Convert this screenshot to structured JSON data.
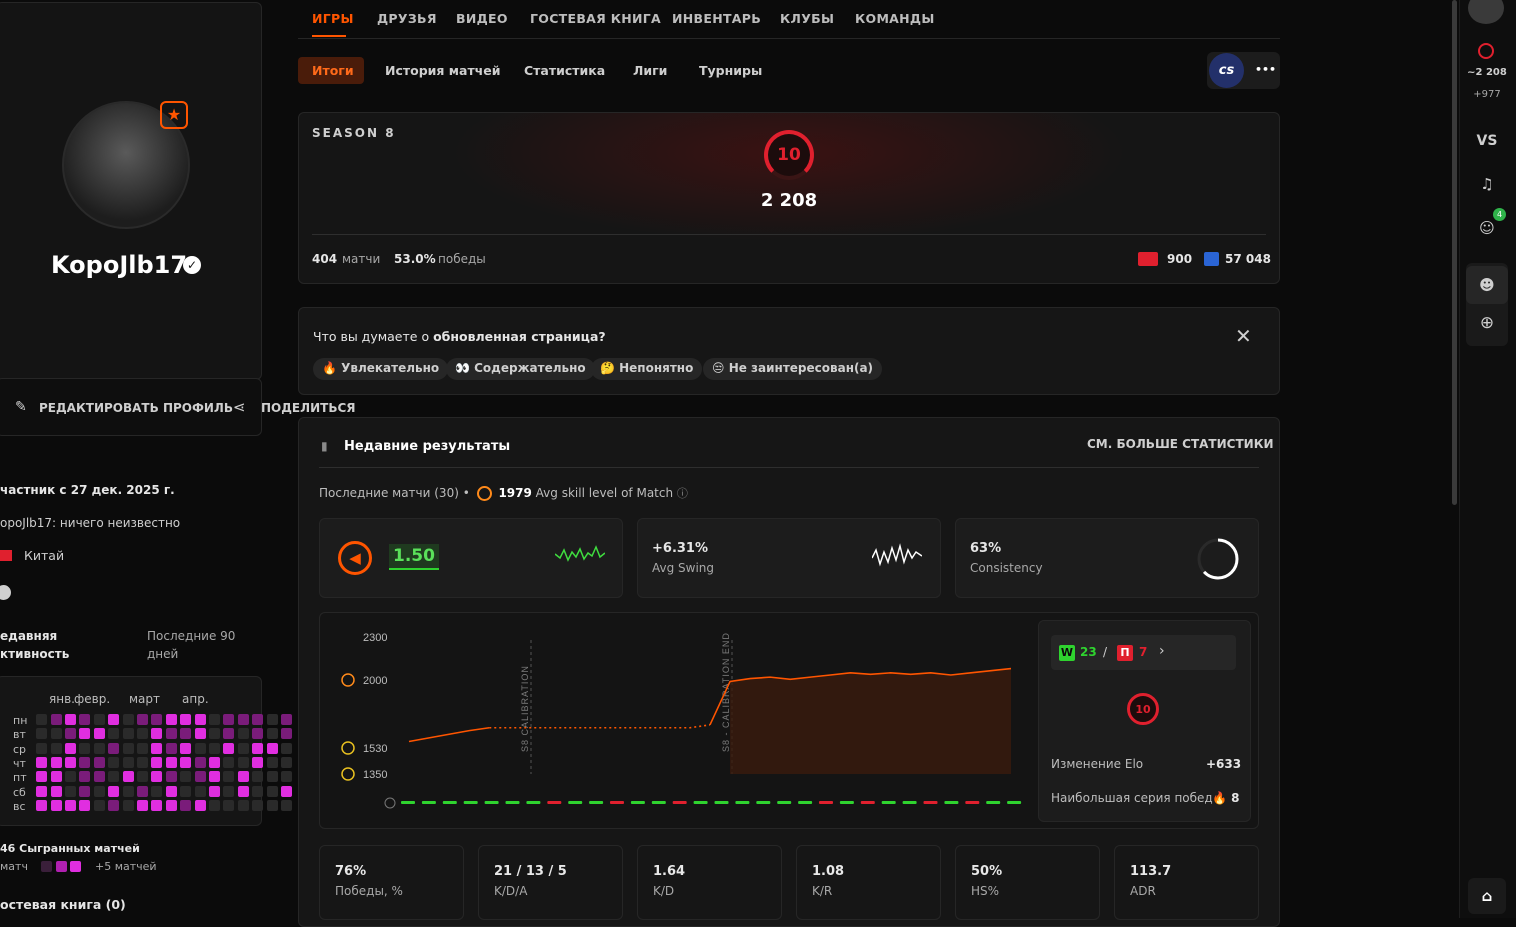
{
  "colors": {
    "accent": "#ff5500",
    "magenta": "#e02ee0",
    "green": "#2fd32f",
    "red": "#e0202e",
    "level": "#e0202e"
  },
  "sidebar": {
    "username": "KopoJlb17",
    "edit_label": "РЕДАКТИРОВАТЬ ПРОФИЛЬ",
    "share_label": "ПОДЕЛИТЬСЯ",
    "member_since": "частник с 27 дек. 2025 г.",
    "bio": "opoJlb17: ничего неизвестно",
    "country": "Китай",
    "activity_title": "едавняя\nктивность",
    "activity_period": "Последние 90\nдней",
    "months": [
      "янв.",
      "февр.",
      "март",
      "апр."
    ],
    "days": [
      "пн",
      "вт",
      "ср",
      "чт",
      "пт",
      "сб",
      "вс"
    ],
    "heatmap": [
      [
        0,
        0,
        0,
        0,
        1,
        2,
        1,
        0,
        2,
        0,
        1,
        1,
        2,
        2,
        2,
        0,
        1,
        1,
        1,
        0,
        1
      ],
      [
        0,
        0,
        0,
        0,
        0,
        1,
        2,
        2,
        0,
        0,
        0,
        2,
        1,
        1,
        2,
        0,
        1,
        0,
        1,
        0,
        1
      ],
      [
        0,
        0,
        0,
        0,
        0,
        2,
        0,
        0,
        1,
        0,
        0,
        2,
        1,
        2,
        0,
        0,
        2,
        0,
        2,
        2,
        0
      ],
      [
        0,
        0,
        0,
        2,
        2,
        2,
        1,
        1,
        0,
        0,
        0,
        2,
        2,
        2,
        1,
        2,
        0,
        0,
        2,
        0,
        0
      ],
      [
        0,
        0,
        0,
        2,
        2,
        0,
        1,
        1,
        0,
        2,
        0,
        2,
        1,
        0,
        1,
        2,
        0,
        2,
        0,
        0,
        0
      ],
      [
        0,
        0,
        0,
        2,
        2,
        0,
        1,
        0,
        2,
        0,
        1,
        0,
        2,
        0,
        0,
        2,
        0,
        2,
        0,
        0,
        2
      ],
      [
        0,
        0,
        0,
        2,
        2,
        2,
        2,
        0,
        1,
        0,
        2,
        2,
        2,
        1,
        2,
        0,
        0,
        0,
        0,
        0,
        0
      ]
    ],
    "played": "46 Сыгранных матчей",
    "legend_left": "матч",
    "legend_right": "+5 матчей",
    "guestbook": "остевая книга (0)"
  },
  "nav": {
    "tabs": [
      "ИГРЫ",
      "ДРУЗЬЯ",
      "ВИДЕО",
      "ГОСТЕВАЯ КНИГА",
      "ИНВЕНТАРЬ",
      "КЛУБЫ",
      "КОМАНДЫ"
    ],
    "subtabs": [
      "Итоги",
      "История матчей",
      "Статистика",
      "Лиги",
      "Турниры"
    ],
    "game_badge": "cs",
    "more": "•••"
  },
  "season": {
    "label": "SEASON 8",
    "level": "10",
    "elo": "2 208",
    "matches": "404",
    "matches_label": "матчи",
    "winrate": "53.0%",
    "winrate_label": "победы",
    "country_rank": "900",
    "region_rank": "57 048"
  },
  "feedback": {
    "question_prefix": "Что вы думаете о ",
    "question_bold": "обновленная страница?",
    "chips": [
      "🔥 Увлекательно",
      "👀 Содержательно",
      "🤔 Непонятно",
      "😒 Не заинтересован(а)"
    ]
  },
  "recent": {
    "title": "Недавние результаты",
    "more": "СМ. БОЛЬШЕ СТАТИСТИКИ",
    "subtitle_prefix": "Последние матчи (30) •",
    "avg_skill": "1979",
    "avg_skill_label": "Avg skill level of Match",
    "rating": "1.50",
    "swing": "+6.31%",
    "swing_label": "Avg Swing",
    "consistency": "63%",
    "consistency_label": "Consistency",
    "consistency_fraction": 0.63,
    "wins": "23",
    "losses": "7",
    "w": "W",
    "l": "П",
    "level": "10",
    "elo_change_label": "Изменение Elo",
    "elo_change": "+633",
    "streak_label": "Наибольшая серия побед",
    "streak": "🔥 8",
    "stats": [
      {
        "v": "76%",
        "l": "Победы, %"
      },
      {
        "v": "21 / 13 / 5",
        "l": "K/D/A"
      },
      {
        "v": "1.64",
        "l": "K/D"
      },
      {
        "v": "1.08",
        "l": "K/R"
      },
      {
        "v": "50%",
        "l": "HS%"
      },
      {
        "v": "113.7",
        "l": "ADR"
      }
    ]
  },
  "chart_data": {
    "type": "line",
    "yticks": [
      "2300",
      "2000",
      "1530",
      "1350"
    ],
    "y_values": [
      2300,
      2000,
      1530,
      1350
    ],
    "markers": [
      "S8 CALIBRATION",
      "S8 - CALIBRATION END"
    ],
    "series": [
      {
        "values": [
          1575,
          1600,
          1625,
          1650,
          1670,
          1670,
          1670,
          1670,
          1670,
          1670,
          1670,
          1670,
          1670,
          1670,
          1670,
          1690,
          1990,
          2010,
          2020,
          2005,
          2020,
          2035,
          2050,
          2040,
          2050,
          2040,
          2050,
          2035,
          2050,
          2065,
          2080
        ]
      }
    ],
    "results": [
      "W",
      "W",
      "W",
      "W",
      "W",
      "W",
      "W",
      "L",
      "W",
      "W",
      "L",
      "W",
      "W",
      "L",
      "W",
      "W",
      "W",
      "W",
      "W",
      "W",
      "L",
      "W",
      "L",
      "W",
      "W",
      "L",
      "W",
      "L",
      "W",
      "W"
    ]
  },
  "rail": {
    "elo": "~2 208",
    "diff": "+977",
    "vs": "VS",
    "badge": "4"
  }
}
